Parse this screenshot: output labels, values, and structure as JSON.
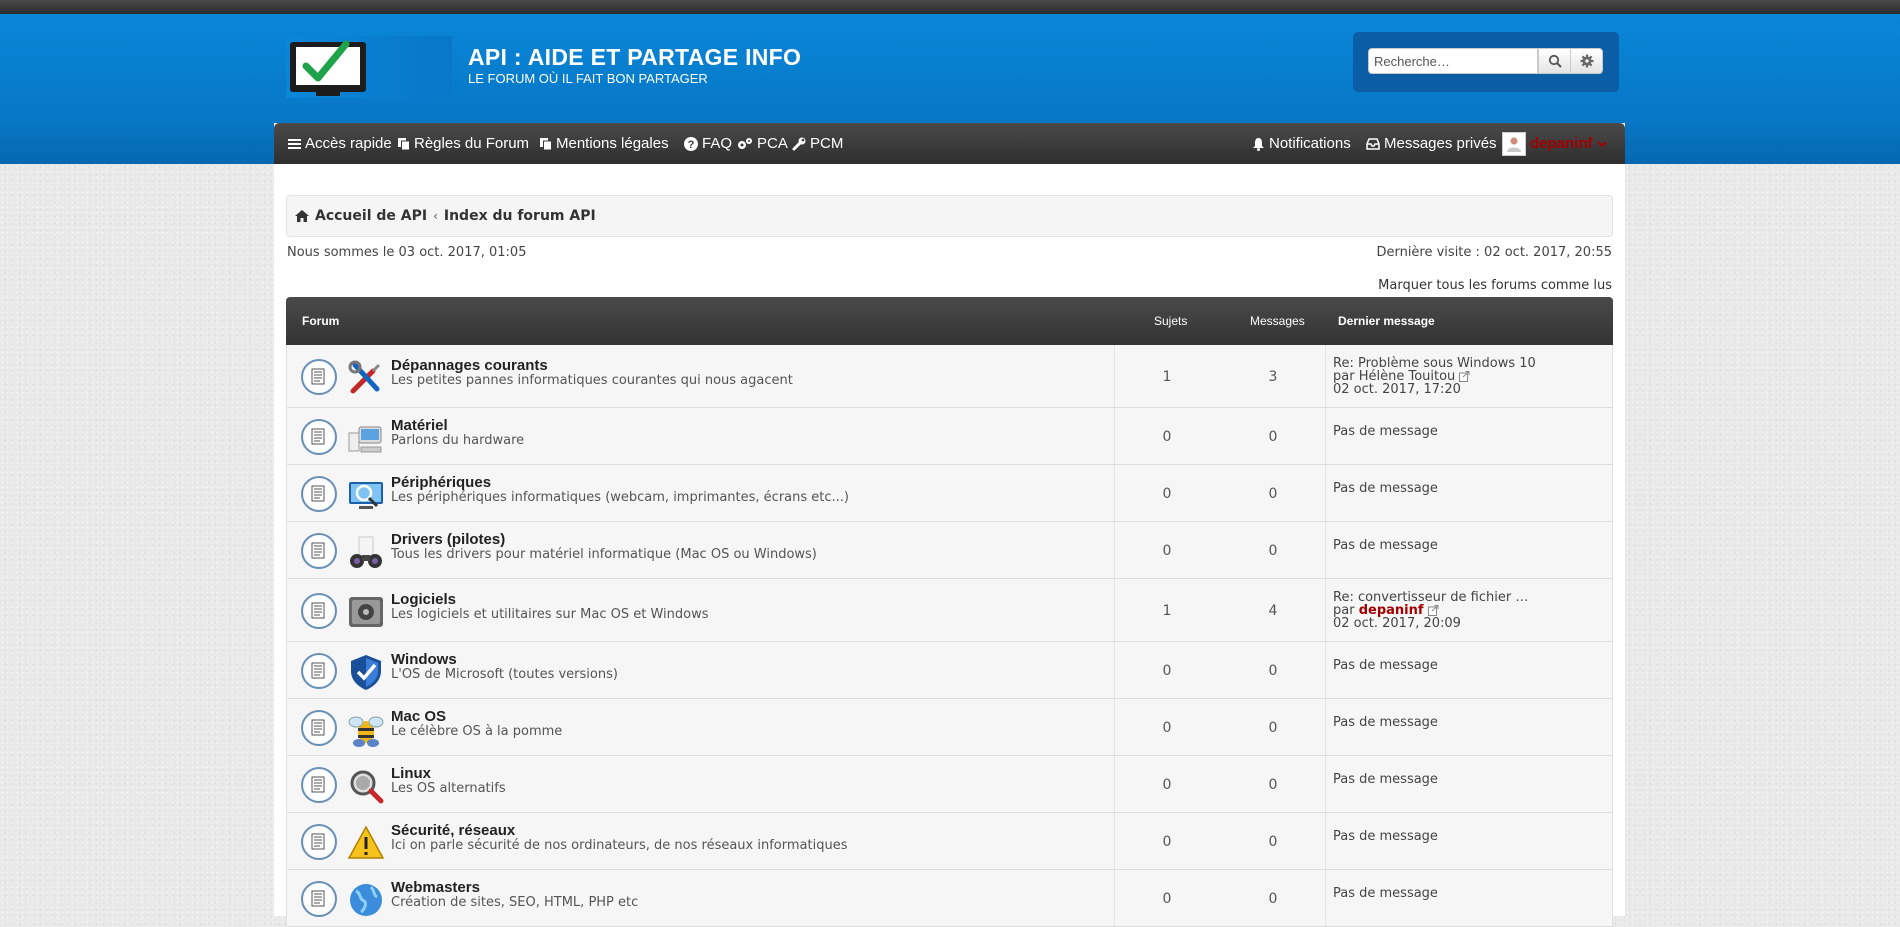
{
  "header": {
    "site_title": "API : AIDE ET PARTAGE INFO",
    "site_subtitle": "LE FORUM OÙ IL FAIT BON PARTAGER"
  },
  "search": {
    "placeholder": "Recherche…"
  },
  "navbar": {
    "quick_access": "Accès rapide",
    "rules": "Règles du Forum",
    "legal": "Mentions légales",
    "faq": "FAQ",
    "pca": "PCA",
    "pcm": "PCM",
    "notifications": "Notifications",
    "private_messages": "Messages privés",
    "username": "depaninf"
  },
  "breadcrumbs": {
    "home": "Accueil de API",
    "index": "Index du forum API"
  },
  "info": {
    "current_date": "Nous sommes le 03 oct. 2017, 01:05",
    "last_visit": "Dernière visite : 02 oct. 2017, 20:55",
    "mark_read": "Marquer tous les forums comme lus"
  },
  "table": {
    "headers": {
      "forum": "Forum",
      "topics": "Sujets",
      "posts": "Messages",
      "last_post": "Dernier message"
    },
    "rows": [
      {
        "title": "Dépannages courants",
        "desc": "Les petites pannes informatiques courantes qui nous agacent",
        "topics": "1",
        "posts": "3",
        "last_title": "Re: Problème sous Windows 10",
        "last_by": "par",
        "last_author": "Hélène Touitou",
        "last_date": "02 oct. 2017, 17:20",
        "icon": "tools-icon"
      },
      {
        "title": "Matériel",
        "desc": "Parlons du hardware",
        "topics": "0",
        "posts": "0",
        "last_none": "Pas de message",
        "icon": "computer-hardware-icon"
      },
      {
        "title": "Périphériques",
        "desc": "Les périphériques informatiques (webcam, imprimantes, écrans etc...)",
        "topics": "0",
        "posts": "0",
        "last_none": "Pas de message",
        "icon": "monitor-magnifier-icon"
      },
      {
        "title": "Drivers (pilotes)",
        "desc": "Tous les drivers pour matériel informatique (Mac OS ou Windows)",
        "topics": "0",
        "posts": "0",
        "last_none": "Pas de message",
        "icon": "binoculars-icon"
      },
      {
        "title": "Logiciels",
        "desc": "Les logiciels et utilitaires sur Mac OS et Windows",
        "topics": "1",
        "posts": "4",
        "last_title": "Re: convertisseur de fichier …",
        "last_by": "par",
        "last_author": "depaninf",
        "last_date": "02 oct. 2017, 20:09",
        "icon": "software-icon"
      },
      {
        "title": "Windows",
        "desc": "L'OS de Microsoft (toutes versions)",
        "topics": "0",
        "posts": "0",
        "last_none": "Pas de message",
        "icon": "shield-icon"
      },
      {
        "title": "Mac OS",
        "desc": "Le célèbre OS à la pomme",
        "topics": "0",
        "posts": "0",
        "last_none": "Pas de message",
        "icon": "bee-icon"
      },
      {
        "title": "Linux",
        "desc": "Les OS alternatifs",
        "topics": "0",
        "posts": "0",
        "last_none": "Pas de message",
        "icon": "magnifier-icon"
      },
      {
        "title": "Sécurité, réseaux",
        "desc": "Ici on parle sécurité de nos ordinateurs, de nos réseaux informatiques",
        "topics": "0",
        "posts": "0",
        "last_none": "Pas de message",
        "icon": "warning-icon"
      },
      {
        "title": "Webmasters",
        "desc": "Création de sites, SEO, HTML, PHP etc",
        "topics": "0",
        "posts": "0",
        "last_none": "Pas de message",
        "icon": "globe-icon"
      }
    ]
  }
}
